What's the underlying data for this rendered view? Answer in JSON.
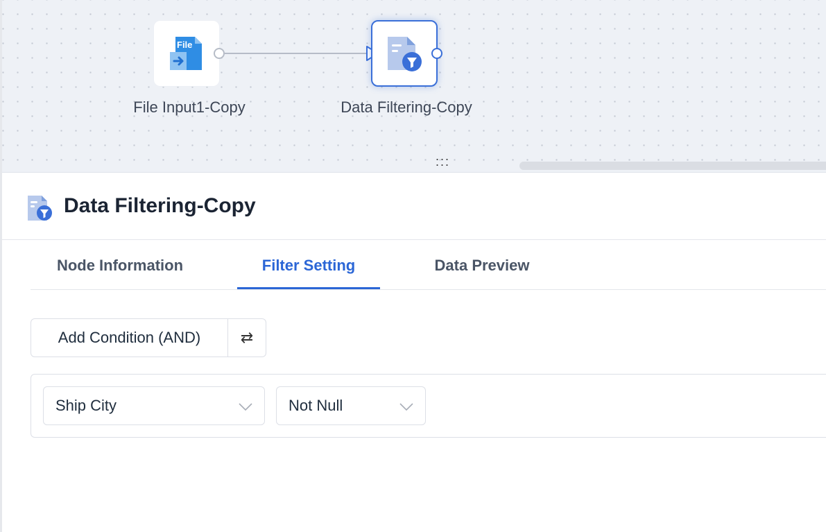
{
  "canvas": {
    "nodes": [
      {
        "label": "File Input1-Copy",
        "icon": "file-input-icon",
        "icon_text": "File"
      },
      {
        "label": "Data Filtering-Copy",
        "icon": "data-filter-icon",
        "selected": true
      }
    ],
    "resize_handle": ":::"
  },
  "panel": {
    "title": "Data Filtering-Copy",
    "icon": "data-filter-icon",
    "tabs": [
      {
        "label": "Node Information",
        "active": false
      },
      {
        "label": "Filter Setting",
        "active": true
      },
      {
        "label": "Data Preview",
        "active": false
      }
    ],
    "add_condition_label": "Add Condition (AND)",
    "swap_icon": "⇄",
    "condition": {
      "field": "Ship City",
      "operator": "Not Null"
    }
  },
  "colors": {
    "accent": "#2b66d6",
    "canvas_bg": "#eef1f6",
    "file_icon_blue": "#2f8de4",
    "filter_icon_blue": "#3a6fd8"
  }
}
